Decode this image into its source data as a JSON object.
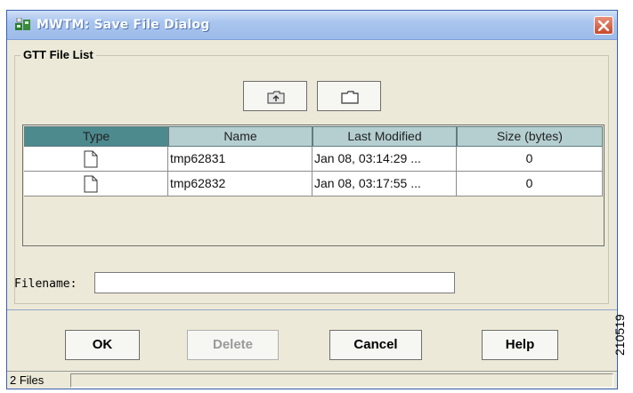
{
  "window": {
    "title": "MWTM: Save File Dialog"
  },
  "group": {
    "title": "GTT File List"
  },
  "toolbar": {
    "up_icon": "up-folder-icon",
    "new_icon": "new-folder-icon"
  },
  "table": {
    "columns": [
      "Type",
      "Name",
      "Last Modified",
      "Size (bytes)"
    ],
    "rows": [
      {
        "type_icon": "file-icon",
        "name": "tmp62831",
        "modified": "Jan 08, 03:14:29 ...",
        "size": "0"
      },
      {
        "type_icon": "file-icon",
        "name": "tmp62832",
        "modified": "Jan 08, 03:17:55 ...",
        "size": "0"
      }
    ]
  },
  "filename": {
    "label": "Filename:",
    "value": ""
  },
  "buttons": {
    "ok": "OK",
    "delete": "Delete",
    "cancel": "Cancel",
    "help": "Help"
  },
  "status": {
    "text": "2 Files"
  },
  "side_label": "210519",
  "colors": {
    "title_gradient": "#a9c5ee",
    "header_selected": "#4d8a8e",
    "header": "#b5cfd1",
    "dialog_bg": "#ece9d8"
  }
}
